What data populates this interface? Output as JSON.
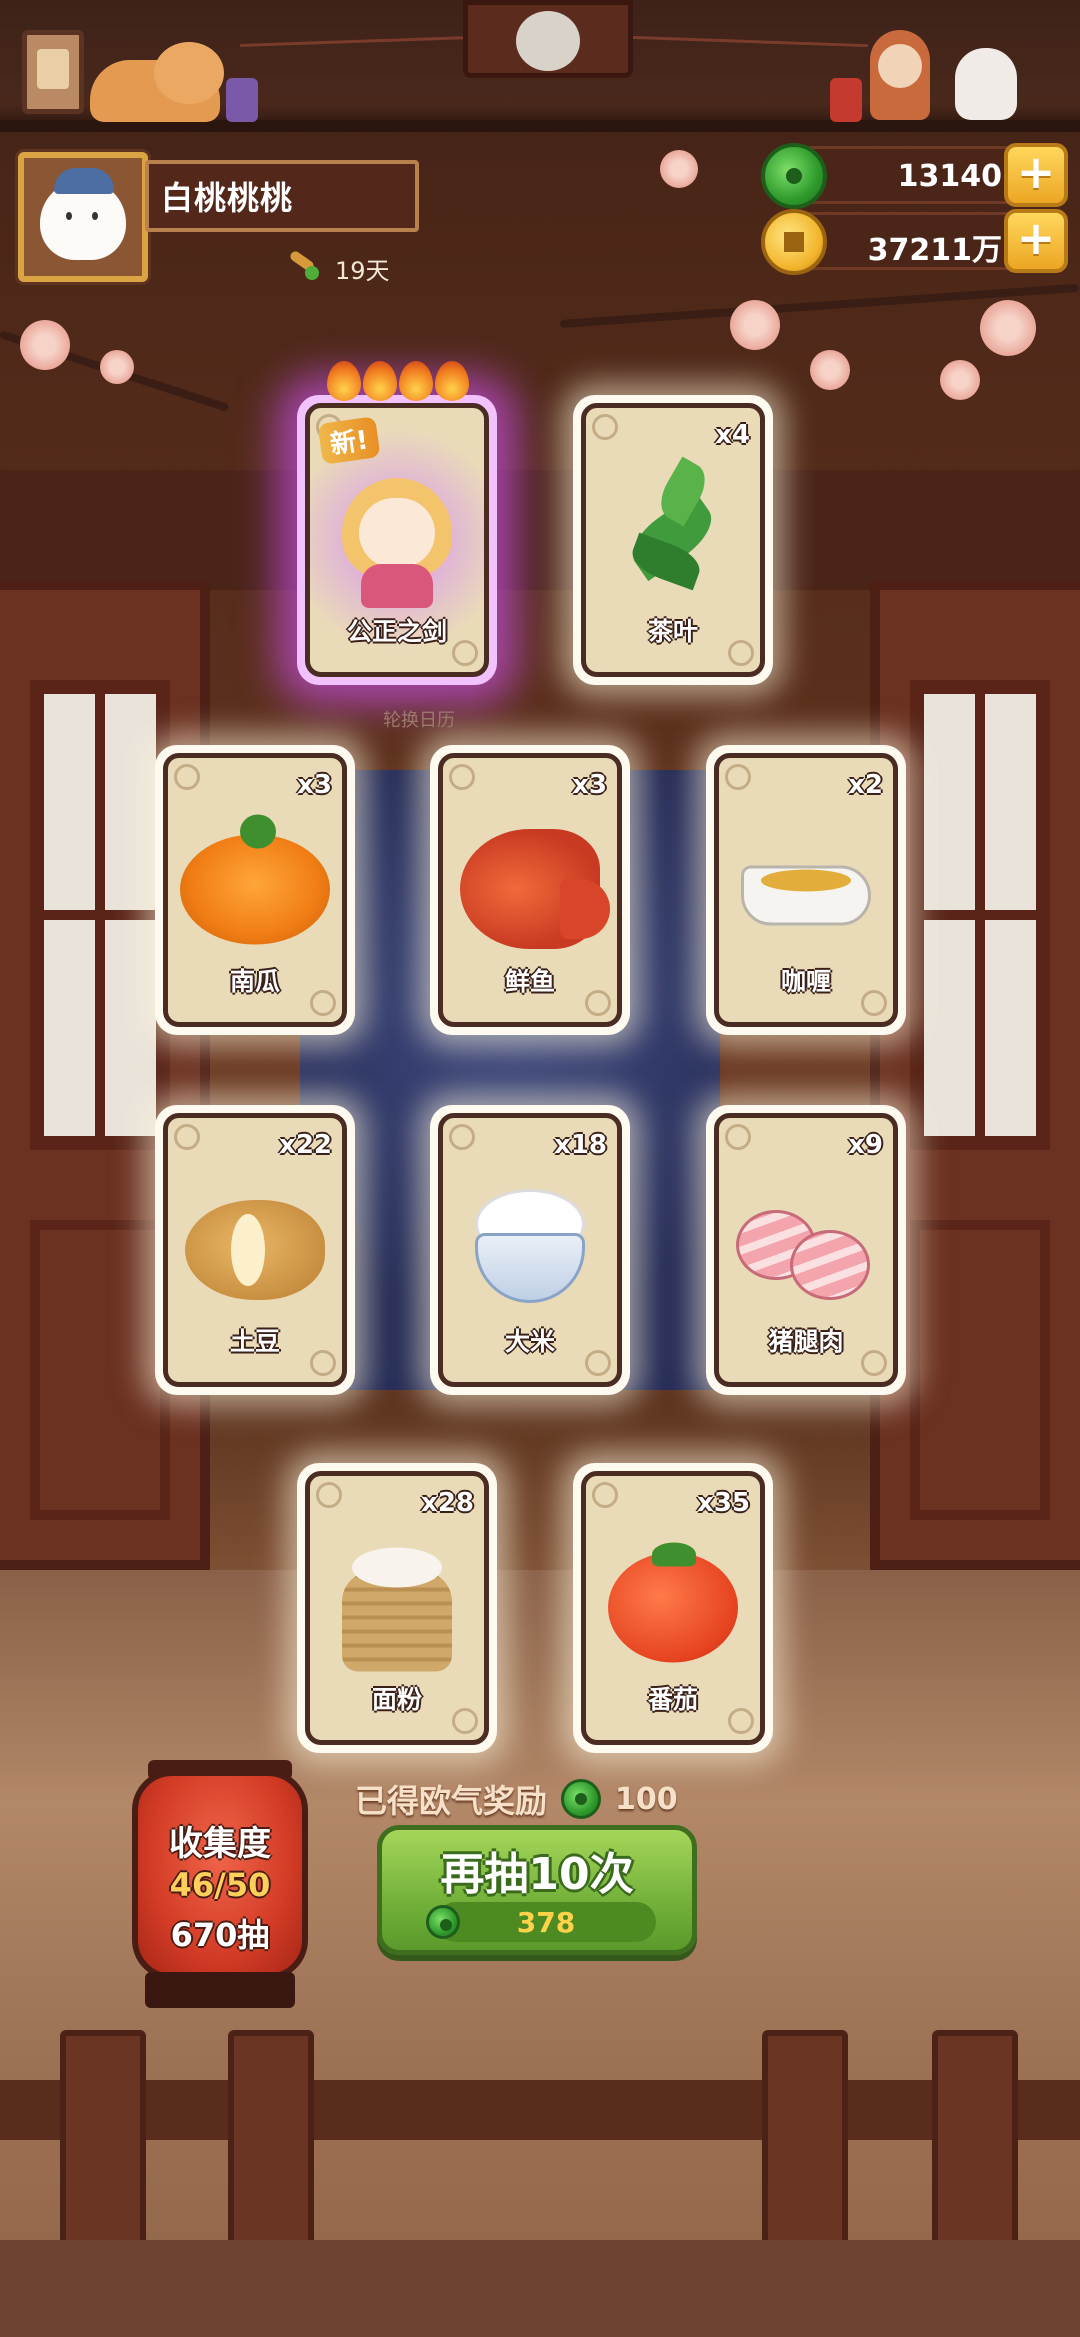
{
  "header": {
    "player_name": "白桃桃桃",
    "days_label": "19天"
  },
  "resources": {
    "jade": {
      "value": "13140",
      "icon": "jade-icon"
    },
    "coins": {
      "value": "37211万",
      "icon": "coin-icon"
    },
    "plus_label": "+"
  },
  "rotate_label": "轮换日历",
  "cards": [
    {
      "name": "公正之剑",
      "count": "",
      "badge": "新!",
      "flames": 4,
      "icon": "girl-character-icon"
    },
    {
      "name": "茶叶",
      "count": "x4",
      "icon": "tea-leaf-icon"
    },
    {
      "name": "南瓜",
      "count": "x3",
      "icon": "pumpkin-icon"
    },
    {
      "name": "鲜鱼",
      "count": "x3",
      "icon": "fish-icon"
    },
    {
      "name": "咖喱",
      "count": "x2",
      "icon": "curry-icon"
    },
    {
      "name": "土豆",
      "count": "x22",
      "icon": "potato-icon"
    },
    {
      "name": "大米",
      "count": "x18",
      "icon": "rice-icon"
    },
    {
      "name": "猪腿肉",
      "count": "x9",
      "icon": "ham-icon"
    },
    {
      "name": "面粉",
      "count": "x28",
      "icon": "flour-icon"
    },
    {
      "name": "番茄",
      "count": "x35",
      "icon": "tomato-icon"
    }
  ],
  "collection": {
    "title": "收集度",
    "progress": "46/50",
    "draws": "670抽"
  },
  "reward": {
    "label": "已得欧气奖励",
    "value": "100"
  },
  "draw_button": {
    "label": "再抽10次",
    "cost": "378"
  }
}
